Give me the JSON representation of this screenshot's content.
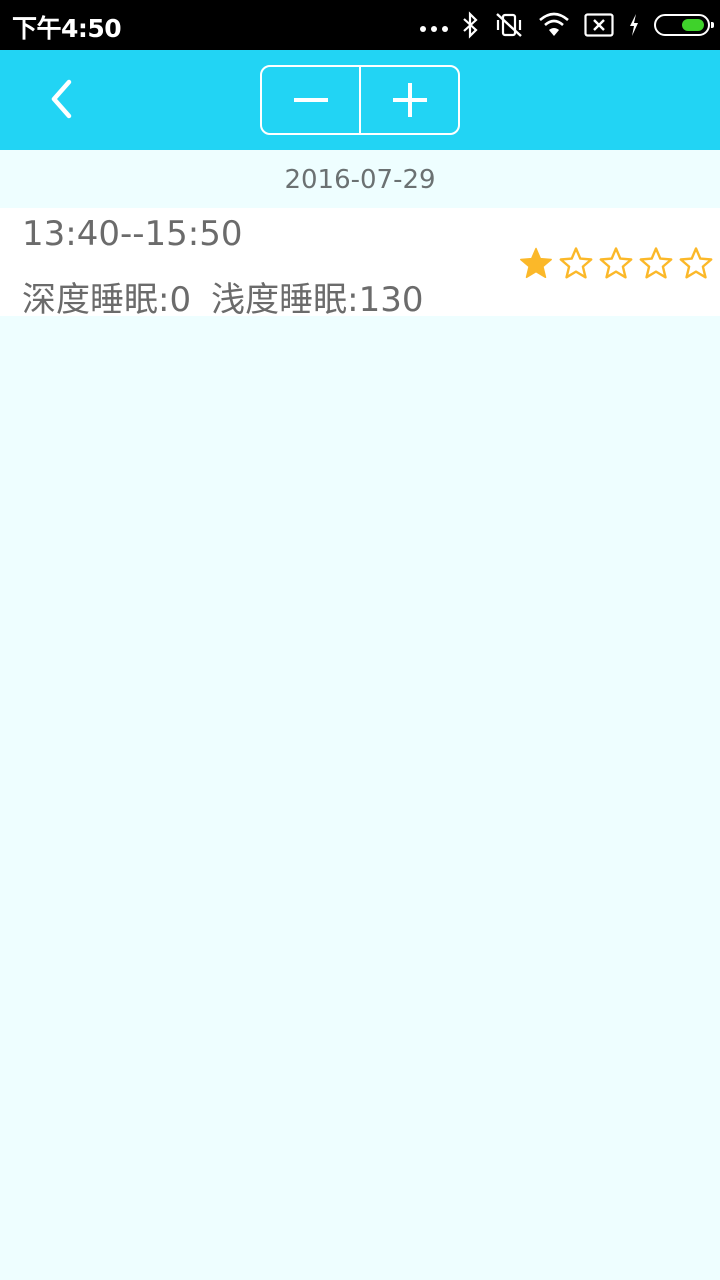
{
  "status_bar": {
    "time": "下午4:50",
    "icons": [
      "more-dots-icon",
      "bluetooth-icon",
      "vibrate-off-icon",
      "wifi-icon",
      "sim-x-icon",
      "charging-icon",
      "battery-icon"
    ],
    "battery_color": "#3fd22b"
  },
  "toolbar": {
    "background": "#22d4f4",
    "back_icon": "chevron-left-icon",
    "zoom_out_icon": "minus-icon",
    "zoom_in_icon": "plus-icon"
  },
  "date": "2016-07-29",
  "records": [
    {
      "time_range": "13:40--15:50",
      "deep_sleep_label": "深度睡眠:",
      "deep_sleep_value": "0",
      "light_sleep_label": "浅度睡眠:",
      "light_sleep_value": "130",
      "rating": 1,
      "rating_max": 5,
      "star_color": "#fbb829"
    }
  ]
}
